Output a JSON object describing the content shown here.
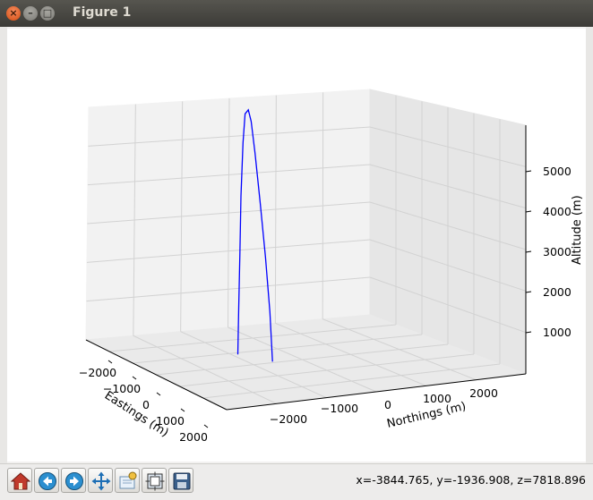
{
  "window": {
    "title": "Figure 1",
    "buttons": {
      "close": "×",
      "minimize": "–",
      "maximize": "□"
    }
  },
  "toolbar": {
    "items": [
      {
        "name": "home-button",
        "icon": "home-icon"
      },
      {
        "name": "back-button",
        "icon": "back-arrow-icon"
      },
      {
        "name": "forward-button",
        "icon": "forward-arrow-icon"
      },
      {
        "name": "pan-button",
        "icon": "pan-arrows-icon"
      },
      {
        "name": "zoom-button",
        "icon": "zoom-rect-icon"
      },
      {
        "name": "subplots-button",
        "icon": "subplots-icon"
      },
      {
        "name": "save-button",
        "icon": "floppy-disk-icon"
      }
    ],
    "coords_readout": "x=-3844.765, y=-1936.908, z=7818.896"
  },
  "chart_data": {
    "type": "line",
    "projection": "3d",
    "grid": true,
    "xlabel": "Eastings (m)",
    "ylabel": "Northings (m)",
    "zlabel": "Altitude (m)",
    "x_ticks": [
      "−2000",
      "−1000",
      "0",
      "1000",
      "2000"
    ],
    "y_ticks": [
      "−2000",
      "−1000",
      "0",
      "1000",
      "2000"
    ],
    "z_ticks": [
      "1000",
      "2000",
      "3000",
      "4000",
      "5000"
    ],
    "xlim": [
      -2500,
      2500
    ],
    "ylim": [
      -2500,
      2500
    ],
    "zlim": [
      0,
      6000
    ],
    "series": [
      {
        "color": "#0000ff",
        "points": [
          {
            "x": 300,
            "y": -700,
            "z": 100
          },
          {
            "x": 250,
            "y": -720,
            "z": 1200
          },
          {
            "x": 180,
            "y": -760,
            "z": 2400
          },
          {
            "x": 100,
            "y": -810,
            "z": 3600
          },
          {
            "x": 20,
            "y": -860,
            "z": 4700
          },
          {
            "x": -30,
            "y": -900,
            "z": 5400
          },
          {
            "x": -70,
            "y": -930,
            "z": 5650
          },
          {
            "x": -120,
            "y": -960,
            "z": 5550
          },
          {
            "x": -150,
            "y": -980,
            "z": 4900
          },
          {
            "x": -180,
            "y": -1000,
            "z": 3700
          },
          {
            "x": -200,
            "y": -1010,
            "z": 2400
          },
          {
            "x": -220,
            "y": -1020,
            "z": 1200
          },
          {
            "x": -230,
            "y": -1030,
            "z": 150
          }
        ]
      }
    ]
  }
}
